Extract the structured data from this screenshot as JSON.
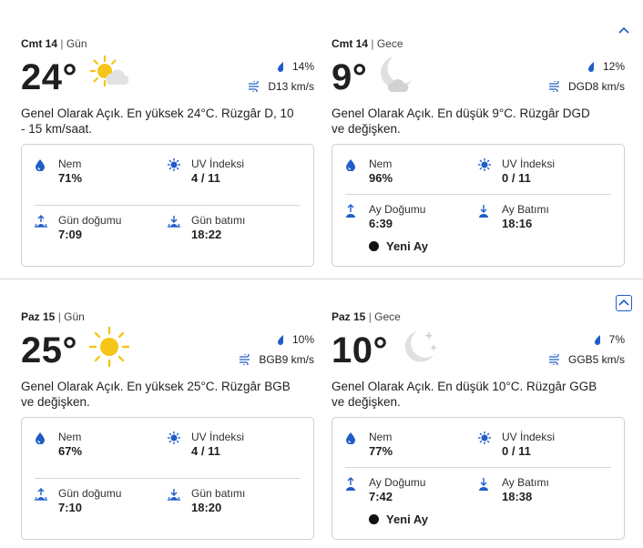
{
  "days": [
    {
      "day": {
        "date": "Cmt 14",
        "sep": "|",
        "period": "Gün",
        "temp": "24°",
        "icon": "sun-with-cloud-icon",
        "precip": "14%",
        "wind": "D13 km/s",
        "desc": "Genel Olarak Açık. En yüksek 24°C. Rüzgâr D, 10 - 15 km/saat.",
        "stats": {
          "humidity_label": "Nem",
          "humidity": "71%",
          "uv_label": "UV İndeksi",
          "uv": "4 / 11",
          "rise_label": "Gün doğumu",
          "rise": "7:09",
          "set_label": "Gün batımı",
          "set": "18:22"
        }
      },
      "night": {
        "date": "Cmt 14",
        "sep": "|",
        "period": "Gece",
        "temp": "9°",
        "icon": "moon-cloud-icon",
        "precip": "12%",
        "wind": "DGD8 km/s",
        "desc": "Genel Olarak Açık. En düşük 9°C. Rüzgâr DGD ve değişken.",
        "stats": {
          "humidity_label": "Nem",
          "humidity": "96%",
          "uv_label": "UV İndeksi",
          "uv": "0 / 11",
          "rise_label": "Ay Doğumu",
          "rise": "6:39",
          "set_label": "Ay Batımı",
          "set": "18:16",
          "moon_phase": "Yeni Ay"
        }
      }
    },
    {
      "day": {
        "date": "Paz 15",
        "sep": "|",
        "period": "Gün",
        "temp": "25°",
        "icon": "sun-icon",
        "precip": "10%",
        "wind": "BGB9 km/s",
        "desc": "Genel Olarak Açık. En yüksek 25°C. Rüzgâr BGB ve değişken.",
        "stats": {
          "humidity_label": "Nem",
          "humidity": "67%",
          "uv_label": "UV İndeksi",
          "uv": "4 / 11",
          "rise_label": "Gün doğumu",
          "rise": "7:10",
          "set_label": "Gün batımı",
          "set": "18:20"
        }
      },
      "night": {
        "date": "Paz 15",
        "sep": "|",
        "period": "Gece",
        "temp": "10°",
        "icon": "moon-stars-icon",
        "precip": "7%",
        "wind": "GGB5 km/s",
        "desc": "Genel Olarak Açık. En düşük 10°C. Rüzgâr GGB ve değişken.",
        "stats": {
          "humidity_label": "Nem",
          "humidity": "77%",
          "uv_label": "UV İndeksi",
          "uv": "0 / 11",
          "rise_label": "Ay Doğumu",
          "rise": "7:42",
          "set_label": "Ay Batımı",
          "set": "18:38",
          "moon_phase": "Yeni Ay"
        }
      }
    }
  ],
  "colors": {
    "accent": "#1f5dc8",
    "sun": "#f5c518",
    "moon": "#dcdcdc"
  }
}
